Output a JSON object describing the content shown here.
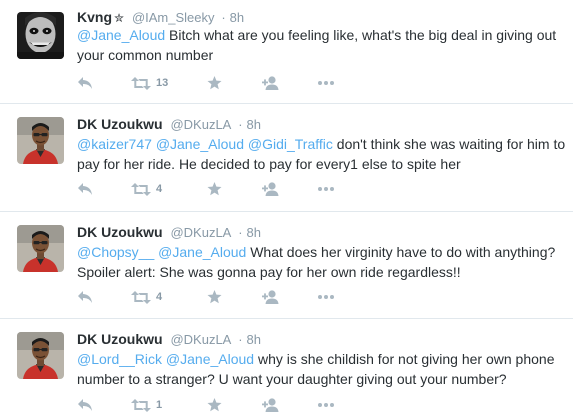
{
  "tweets": [
    {
      "name": "Kvng",
      "name_symbol": "✮",
      "handle": "@IAm_Sleeky",
      "separator": "·",
      "time": "8h",
      "text_parts": [
        {
          "text": "@Jane_Aloud",
          "mention": true
        },
        {
          "text": " Bitch what are you feeling like, what's the big deal in giving out your common number",
          "mention": false
        }
      ],
      "retweet_count": "13",
      "avatar": "joker-face-avatar"
    },
    {
      "name": "DK Uzoukwu",
      "handle": "@DKuzLA",
      "separator": "·",
      "time": "8h",
      "text_parts": [
        {
          "text": "@kaizer747",
          "mention": true
        },
        {
          "text": " ",
          "mention": false
        },
        {
          "text": "@Jane_Aloud",
          "mention": true
        },
        {
          "text": " ",
          "mention": false
        },
        {
          "text": "@Gidi_Traffic",
          "mention": true
        },
        {
          "text": " don't think she was waiting for him to pay for her ride. He decided to pay for every1 else to spite her",
          "mention": false
        }
      ],
      "retweet_count": "4",
      "avatar": "man-red-shirt-avatar"
    },
    {
      "name": "DK Uzoukwu",
      "handle": "@DKuzLA",
      "separator": "·",
      "time": "8h",
      "text_parts": [
        {
          "text": "@Chopsy__",
          "mention": true
        },
        {
          "text": " ",
          "mention": false
        },
        {
          "text": "@Jane_Aloud",
          "mention": true
        },
        {
          "text": " What does her virginity have to do with anything? Spoiler alert: She was gonna pay for her own ride regardless!!",
          "mention": false
        }
      ],
      "retweet_count": "4",
      "avatar": "man-red-shirt-avatar"
    },
    {
      "name": "DK Uzoukwu",
      "handle": "@DKuzLA",
      "separator": "·",
      "time": "8h",
      "text_parts": [
        {
          "text": "@Lord__Rick",
          "mention": true
        },
        {
          "text": " ",
          "mention": false
        },
        {
          "text": "@Jane_Aloud",
          "mention": true
        },
        {
          "text": " why is she childish for not giving her own phone number to a stranger? U want your daughter giving out your number?",
          "mention": false
        }
      ],
      "retweet_count": "1",
      "avatar": "man-red-shirt-avatar"
    }
  ],
  "icons": {
    "reply": "reply-icon",
    "retweet": "retweet-icon",
    "favorite": "star-icon",
    "follow": "follow-icon",
    "more": "more-icon"
  },
  "colors": {
    "mention": "#55acee",
    "text": "#292f33",
    "meta": "#8899a6",
    "icon": "#aab8c2",
    "divider": "#e1e8ed"
  }
}
